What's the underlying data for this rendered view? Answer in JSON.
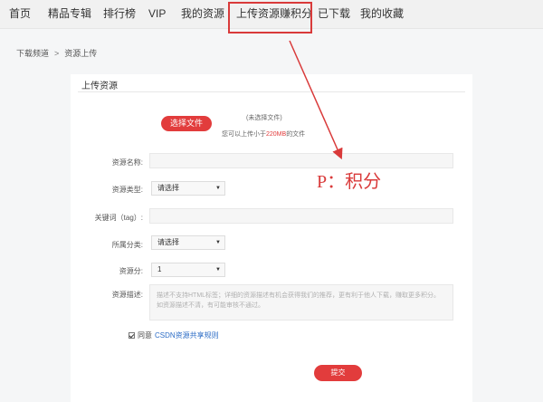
{
  "nav": {
    "items": [
      "首页",
      "精品专辑",
      "排行榜",
      "VIP",
      "我的资源",
      "上传资源赚积分",
      "已下载",
      "我的收藏"
    ],
    "active_index": 5
  },
  "breadcrumb": {
    "parent": "下载频道",
    "separator": ">",
    "current": "资源上传"
  },
  "panel": {
    "title": "上传资源",
    "choose_button": "选择文件",
    "no_file": "(未选择文件)",
    "limit_prefix": "您可以上传小于",
    "limit_size": "220MB",
    "limit_suffix": "的文件"
  },
  "form": {
    "name_label": "资源名称:",
    "type_label": "资源类型:",
    "type_value": "请选择",
    "tag_label": "关键词（tag）:",
    "category_label": "所属分类:",
    "category_value": "请选择",
    "points_label": "资源分:",
    "points_value": "1",
    "desc_label": "资源描述:",
    "desc_placeholder": "描述不支持HTML标签；详细的资源描述有机会获得我们的推荐，更有利于他人下载，赚取更多积分。如资源描述不清，有可能审核不通过。"
  },
  "agree": {
    "checked": true,
    "text": "同意",
    "link": "CSDN资源共享规则"
  },
  "submit_label": "提交",
  "annotation": {
    "text": "P：积分",
    "color": "#d93a3a"
  },
  "colors": {
    "accent": "#e23c3c",
    "link": "#2d6dc6",
    "annotation": "#d93a3a"
  }
}
